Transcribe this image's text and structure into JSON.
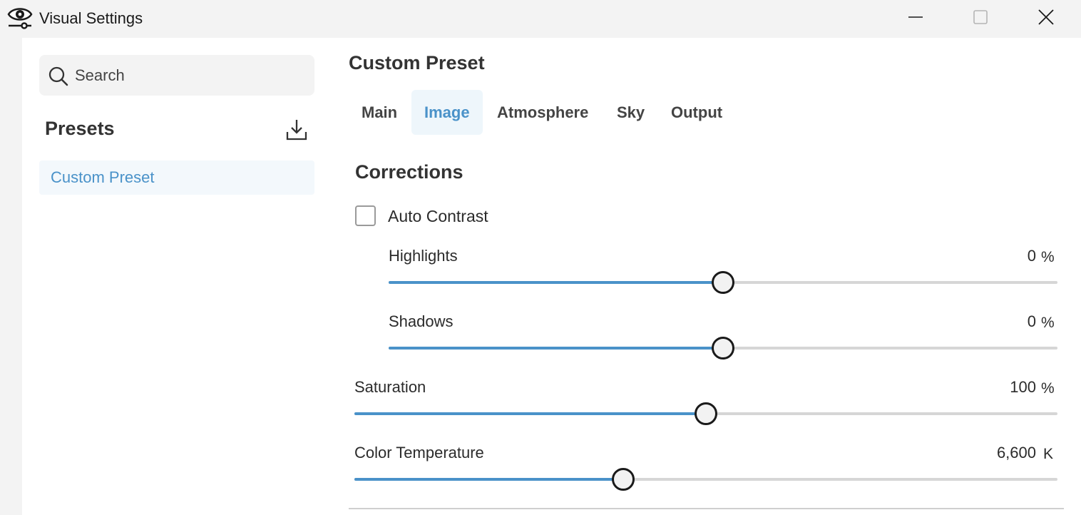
{
  "window": {
    "title": "Visual Settings"
  },
  "search": {
    "placeholder": "Search",
    "value": ""
  },
  "presets": {
    "title": "Presets",
    "items": [
      {
        "label": "Custom Preset",
        "selected": true
      }
    ]
  },
  "panel": {
    "title": "Custom Preset",
    "tabs": [
      {
        "label": "Main",
        "active": false
      },
      {
        "label": "Image",
        "active": true
      },
      {
        "label": "Atmosphere",
        "active": false
      },
      {
        "label": "Sky",
        "active": false
      },
      {
        "label": "Output",
        "active": false
      }
    ]
  },
  "corrections": {
    "title": "Corrections",
    "auto_contrast": {
      "label": "Auto Contrast",
      "checked": false
    },
    "sliders": [
      {
        "label": "Highlights",
        "value": "0",
        "unit": "%",
        "position": 0.5
      },
      {
        "label": "Shadows",
        "value": "0",
        "unit": "%",
        "position": 0.5
      },
      {
        "label": "Saturation",
        "value": "100",
        "unit": "%",
        "position": 0.5
      },
      {
        "label": "Color Temperature",
        "value": "6,600",
        "unit": "K",
        "position": 0.382
      }
    ]
  },
  "colors": {
    "accent": "#4a92c9",
    "track": "#d6d6d6",
    "window_bg": "#f3f3f3",
    "content_bg": "#ffffff"
  },
  "icons": {
    "app": "eye-settings-icon",
    "search": "search-icon",
    "download": "download-icon",
    "minimize": "minimize-icon",
    "maximize": "maximize-icon",
    "close": "close-icon"
  }
}
